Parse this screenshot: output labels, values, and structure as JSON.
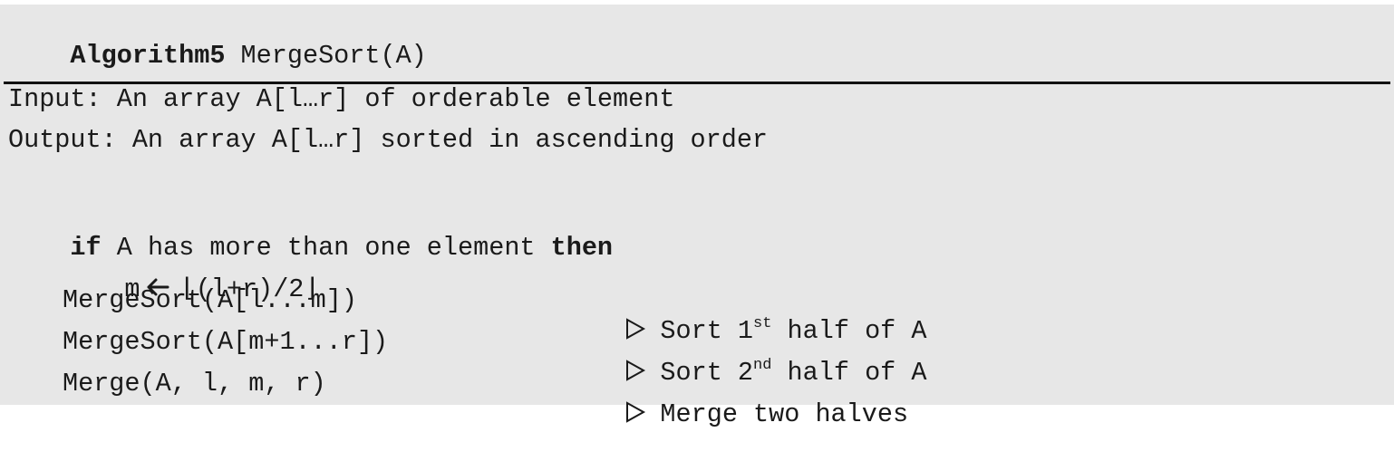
{
  "header": {
    "keyword": "Algorithm5",
    "name": " MergeSort(A)"
  },
  "io": {
    "input": "Input: An array A[l…r] of orderable element",
    "output": "Output: An array A[l…r] sorted in ascending order"
  },
  "code": {
    "if_kw": "if",
    "if_cond": " A has more than one element ",
    "then_kw": "then",
    "assign_var": "m",
    "assign_expr": "⌊(l+r)/2⌋",
    "call1": "MergeSort(A[l...m])",
    "call2": "MergeSort(A[m+1...r])",
    "call3": "Merge(A, l, m, r)",
    "comment1_pre": "Sort 1",
    "comment1_sup": "st",
    "comment1_post": " half of A",
    "comment2_pre": "Sort 2",
    "comment2_sup": "nd",
    "comment2_post": " half of A",
    "comment3": "Merge two halves"
  },
  "icons": {
    "comment_marker": "triangle-right-outline-icon",
    "assign_arrow": "left-arrow-icon"
  },
  "colors": {
    "background": "#e7e7e7",
    "text": "#1a1a1a"
  }
}
